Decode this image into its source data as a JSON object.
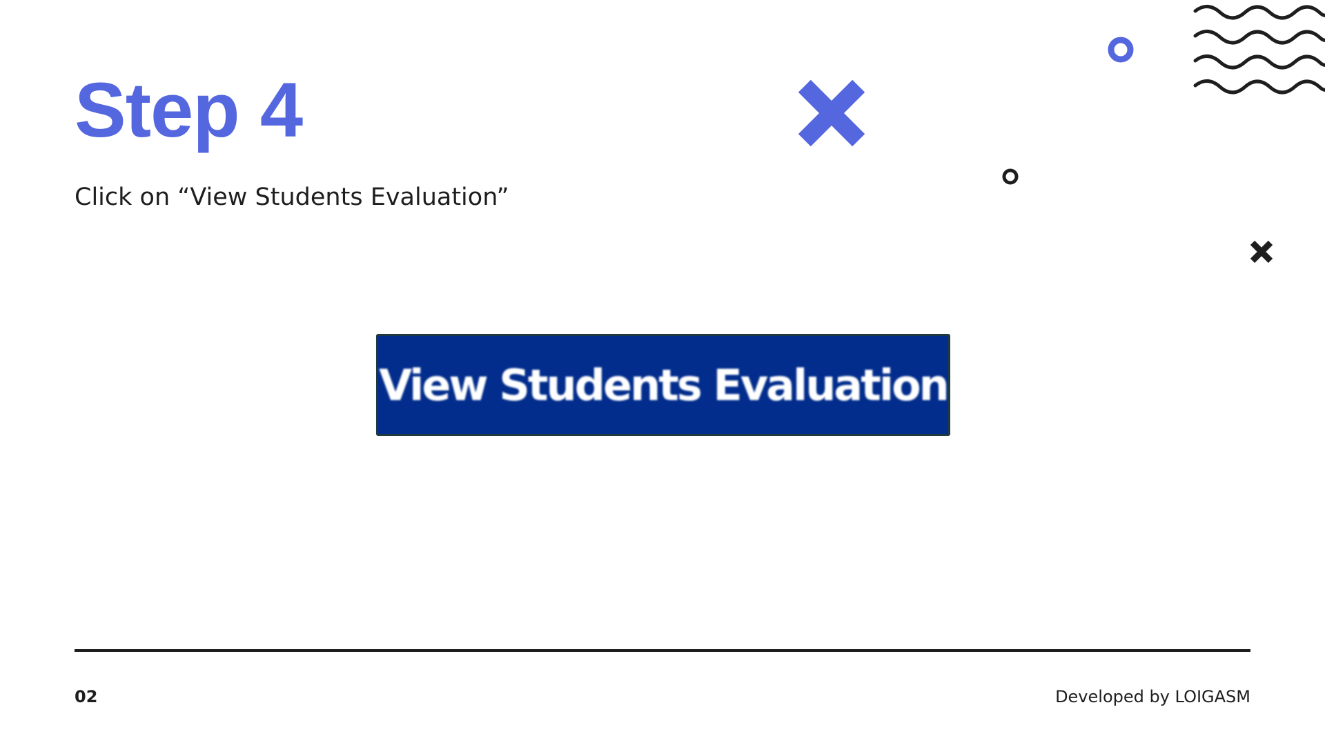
{
  "slide": {
    "title": "Step 4",
    "instruction": "Click on “View Students Evaluation”"
  },
  "button": {
    "label": "View Students Evaluation",
    "background_color": "#022d8c"
  },
  "footer": {
    "page_number": "02",
    "credit": "Developed by LOIGASM"
  },
  "colors": {
    "accent": "#5467df",
    "text": "#1e1e1e",
    "background": "#ffffff"
  },
  "decorations": {
    "icons": [
      "cross-icon",
      "ring-icon",
      "wave-lines-icon"
    ]
  }
}
